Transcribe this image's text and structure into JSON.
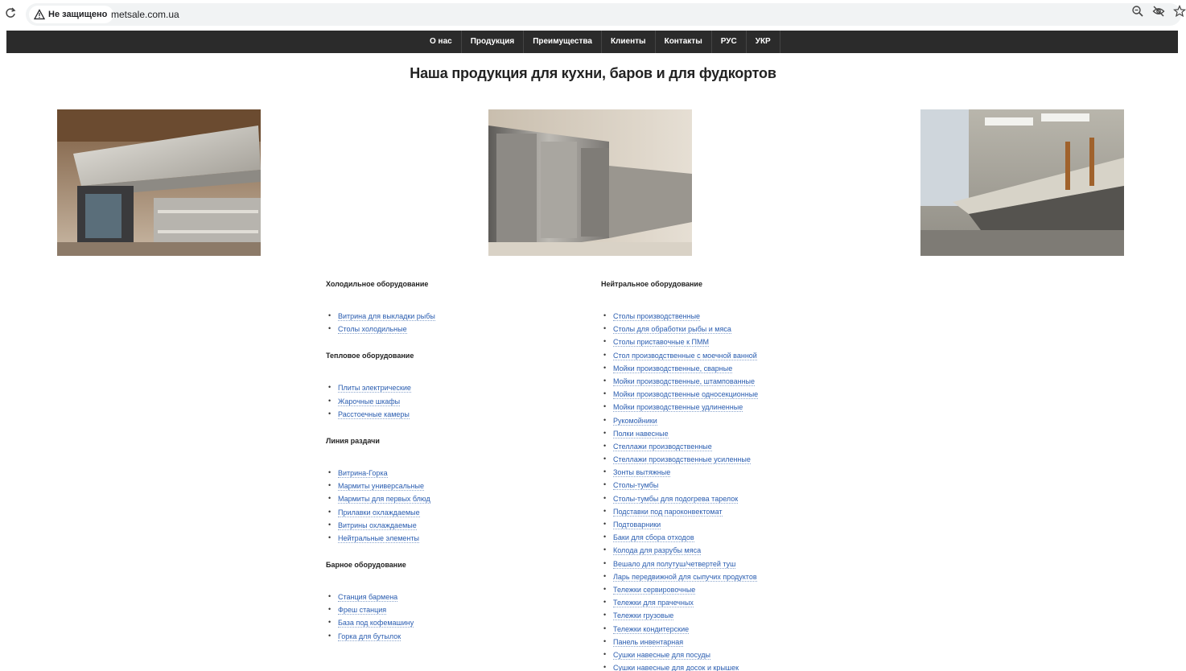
{
  "browser": {
    "security_label": "Не защищено",
    "url": "metsale.com.ua",
    "icons": [
      "reload-icon",
      "warning-icon",
      "zoom-icon",
      "eye-off-icon",
      "star-icon"
    ]
  },
  "nav": {
    "items": [
      "О нас",
      "Продукция",
      "Преимущества",
      "Клиенты",
      "Контакты",
      "РУС",
      "УКР"
    ]
  },
  "page": {
    "title": "Наша продукция для кухни, баров и для фудкортов"
  },
  "left_column": {
    "categories": [
      {
        "title": "Холодильное оборудование",
        "items": [
          "Витрина для выкладки рыбы",
          "Столы холодильные"
        ]
      },
      {
        "title": "Тепловое оборудование",
        "items": [
          "Плиты электрические",
          "Жарочные шкафы",
          "Расстоечные камеры"
        ]
      },
      {
        "title": "Линия раздачи",
        "items": [
          "Витрина-Горка",
          "Мармиты универсальные",
          "Мармиты для первых блюд",
          "Прилавки охлаждаемые",
          "Витрины охлаждаемые",
          "Нейтральные элементы"
        ]
      },
      {
        "title": "Барное оборудование",
        "items": [
          "Станция бармена",
          "Фреш станция",
          "База под кофемашину",
          "Горка для бутылок"
        ]
      }
    ]
  },
  "right_column": {
    "title": "Нейтральное оборудование",
    "items": [
      "Столы производственные",
      "Столы для обработки рыбы и мяса",
      "Столы приставочные к ПММ",
      "Стол производственные с моечной ванной",
      "Мойки производственные, сварные",
      "Мойки производственные, штампованные",
      "Мойки производственные односекционные",
      "Мойки производственные удлиненные",
      "Рукомойники",
      "Полки навесные",
      "Стеллажи производственные",
      "Стеллажи производственные усиленные",
      "Зонты вытяжные",
      "Столы-тумбы",
      "Столы-тумбы для подогрева тарелок",
      "Подставки под пароконвектомат",
      "Подтоварники",
      "Баки для сбора отходов",
      "Колода для разрубы мяса",
      "Вешало для полутуш/четвертей туш",
      "Ларь передвижной для сыпучих продуктов",
      "Тележки сервировочные",
      "Тележки для прачечных",
      "Тележки грузовые",
      "Тележки кондитерские",
      "Панель инвентарная",
      "Сушки навесные для посуды",
      "Сушки навесные для досок и крышек"
    ]
  }
}
